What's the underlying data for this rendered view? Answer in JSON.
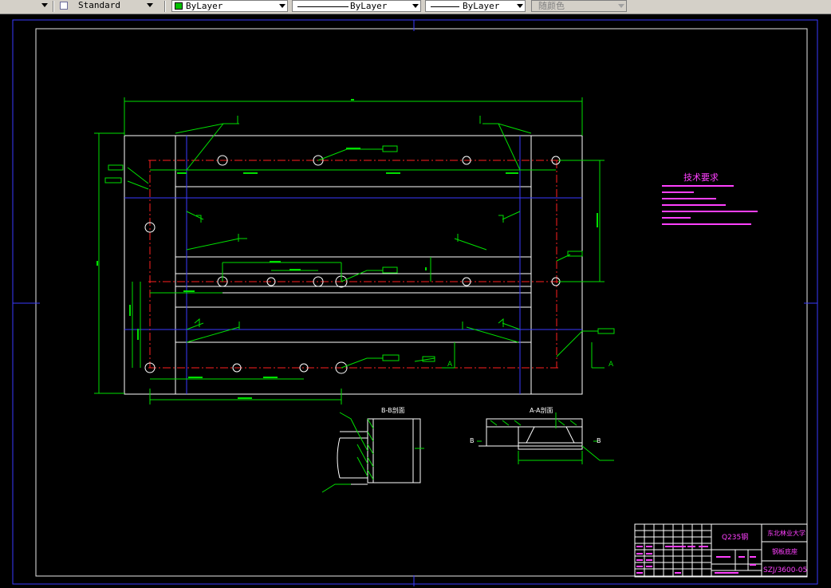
{
  "toolbar": {
    "text_style": "Standard",
    "color": "ByLayer",
    "linetype": "ByLayer",
    "lineweight": "ByLayer",
    "plot_style": "随颜色"
  },
  "drawing": {
    "technical_requirements": {
      "title": "技术要求"
    },
    "section_views": {
      "b_b": "B-B剖面",
      "a_a": "A-A剖面",
      "label_a": "A",
      "label_b": "B"
    },
    "title_block": {
      "material": "Q235钢",
      "school": "东北林业大学",
      "part_name": "钢板底座",
      "drawing_no": "SZJ/3600-05"
    }
  }
}
